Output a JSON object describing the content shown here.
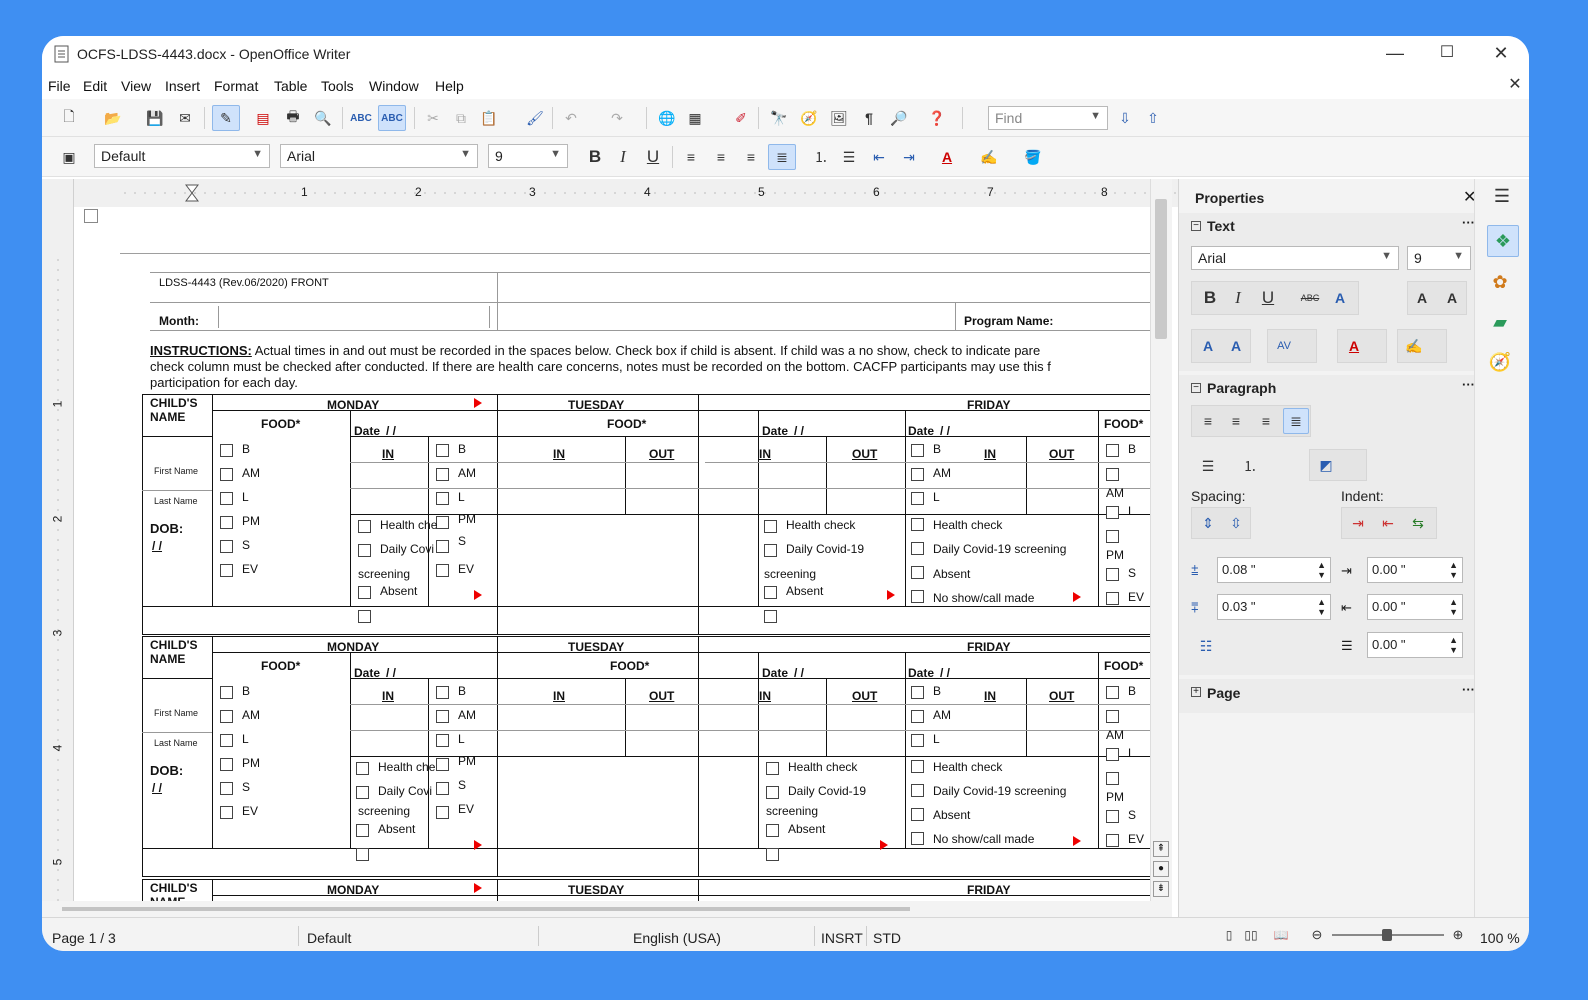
{
  "window": {
    "title": "OCFS-LDSS-4443.docx - OpenOffice Writer",
    "minimize": "—",
    "maximize": "☐",
    "close": "✕",
    "close_doc": "✕"
  },
  "menu": [
    "File",
    "Edit",
    "View",
    "Insert",
    "Format",
    "Table",
    "Tools",
    "Window",
    "Help"
  ],
  "format_bar": {
    "style": "Default",
    "font": "Arial",
    "size": "9"
  },
  "find": {
    "placeholder": "Find"
  },
  "doc": {
    "header": "LDSS-4443 (Rev.06/2020) FRONT",
    "month_label": "Month:",
    "program_label": "Program Name:",
    "instr_bold": "INSTRUCTIONS:",
    "instr_line1": " Actual times in and out must be recorded in the spaces below.  Check box if child is absent.  If child was a no show, check to indicate pare",
    "instr_line2": "check column must be checked after conducted. If there are health care concerns, notes must be recorded on the bottom.  CACFP participants may use this f",
    "instr_line3": "participation for each day.",
    "childs": "CHILD'S",
    "name": "NAME",
    "monday": "MONDAY",
    "tuesday": "TUESDAY",
    "friday": "FRIDAY",
    "food": "FOOD*",
    "date": "Date",
    "date_slash": "/ /",
    "in": "IN",
    "out": "OUT",
    "first_name": "First Name",
    "last_name": "Last Name",
    "dob": "DOB:",
    "dob_slash": "/ /",
    "meals": [
      "B",
      "AM",
      "L",
      "PM",
      "S",
      "EV"
    ],
    "health": "Health check",
    "health_cut": "Health che",
    "covid": "Daily Covid-19",
    "covid_cut": "Daily Covi",
    "covid_full": "Daily Covid-19 screening",
    "screening": "screening",
    "absent": "Absent",
    "noshow": "No show/call made",
    "noshow_cut": "No show/call made"
  },
  "status": {
    "page": "Page 1 / 3",
    "style": "Default",
    "language": "English (USA)",
    "insrt": "INSRT",
    "std": "STD",
    "zoom": "100 %"
  },
  "sidebar": {
    "title": "Properties",
    "text_section": "Text",
    "font": "Arial",
    "size": "9",
    "paragraph_section": "Paragraph",
    "spacing": "Spacing:",
    "indent": "Indent:",
    "above": "0.08 \"",
    "below": "0.03 \"",
    "indent_before": "0.00 \"",
    "indent_after": "0.00 \"",
    "indent_first": "0.00 \"",
    "page_section": "Page",
    "more": "···"
  },
  "ruler": {
    "h": [
      "1",
      "2",
      "3",
      "4",
      "5",
      "6",
      "7",
      "8"
    ],
    "v": [
      "1",
      "2",
      "3",
      "4",
      "5"
    ]
  }
}
